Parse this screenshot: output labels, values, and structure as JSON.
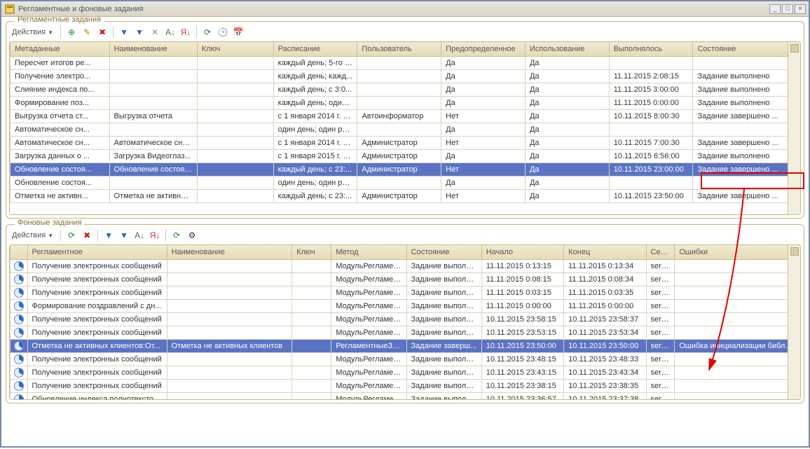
{
  "window": {
    "title": "Регламентные и фоновые задания",
    "min": "_",
    "max": "□",
    "close": "×"
  },
  "panel1": {
    "legend": "Регламентные задания",
    "actions": "Действия",
    "columns": [
      "Метаданные",
      "Наименование",
      "Ключ",
      "Расписание",
      "Пользователь",
      "Предопределенное",
      "Использование",
      "Выполнялось",
      "Состояние"
    ],
    "rows": [
      {
        "c": [
          "Пересчет итогов ре...",
          "",
          "",
          "каждый день; 5-го ч...",
          "",
          "Да",
          "Да",
          "",
          ""
        ]
      },
      {
        "c": [
          "Получение электро...",
          "",
          "",
          "каждый день; кажд...",
          "",
          "Да",
          "Да",
          "11.11.2015 2:08:15",
          "Задание выполнено"
        ]
      },
      {
        "c": [
          "Слияние индекса по...",
          "",
          "",
          "каждый день; с 3:0...",
          "",
          "Да",
          "Да",
          "11.11.2015 3:00:00",
          "Задание выполнено"
        ]
      },
      {
        "c": [
          "Формирование поз...",
          "",
          "",
          "каждый день; один ...",
          "",
          "Да",
          "Да",
          "11.11.2015 0:00:00",
          "Задание выполнено"
        ]
      },
      {
        "c": [
          "Выгрузка отчета ст...",
          "Выгрузка отчета",
          "",
          "с 1 января 2014 г. к...",
          "Автоинформатор",
          "Нет",
          "Да",
          "10.11.2015 8:00:30",
          "Задание завершено ..."
        ]
      },
      {
        "c": [
          "Автоматическое сн...",
          "",
          "",
          "один день; один раз...",
          "",
          "Да",
          "Да",
          "",
          ""
        ]
      },
      {
        "c": [
          "Автоматическое сн...",
          "Автоматическое сня...",
          "",
          "с 1 января 2014 г. к...",
          "Администратор",
          "Нет",
          "Да",
          "10.11.2015 7:00:30",
          "Задание завершено ..."
        ]
      },
      {
        "c": [
          "Загрузка данных о ...",
          "Загрузка Видеоглаз...",
          "",
          "с 1 января 2015 г. к...",
          "Администратор",
          "Да",
          "Да",
          "10.11.2015 6:56:00",
          "Задание выполнено"
        ]
      },
      {
        "c": [
          "Обновление состоя...",
          "Обновление состоян...",
          "",
          "каждый день; с 23:...",
          "Администратор",
          "Нет",
          "Да",
          "10.11.2015 23:00:00",
          "Задание завершено ..."
        ],
        "sel": true
      },
      {
        "c": [
          "Обновление состоя...",
          "",
          "",
          "один день; один раз...",
          "",
          "Да",
          "Да",
          "",
          ""
        ]
      },
      {
        "c": [
          "Отметка не активн...",
          "Отметка не активны...",
          "",
          "каждый день; с 23:...",
          "Администратор",
          "Нет",
          "Да",
          "10.11.2015 23:50:00",
          "Задание завершено ..."
        ]
      }
    ]
  },
  "panel2": {
    "legend": "Фоновые задания",
    "actions": "Действия",
    "columns": [
      "",
      "Регламентное",
      "Наименование",
      "Ключ",
      "Метод",
      "Состояние",
      "Начало",
      "Конец",
      "Сер...",
      "Ошибки"
    ],
    "rows": [
      {
        "c": [
          "",
          "Получение электронных сообщений",
          "",
          "",
          "МодульРегламен...",
          "Задание выполне...",
          "11.11.2015 0:13:15",
          "11.11.2015 0:13:34",
          "serv...",
          ""
        ]
      },
      {
        "c": [
          "",
          "Получение электронных сообщений",
          "",
          "",
          "МодульРегламен...",
          "Задание выполне...",
          "11.11.2015 0:08:15",
          "11.11.2015 0:08:34",
          "serv...",
          ""
        ]
      },
      {
        "c": [
          "",
          "Получение электронных сообщений",
          "",
          "",
          "МодульРегламен...",
          "Задание выполне...",
          "11.11.2015 0:03:15",
          "11.11.2015 0:03:35",
          "serv...",
          ""
        ]
      },
      {
        "c": [
          "",
          "Формирование поздравлений с дн...",
          "",
          "",
          "МодульРегламен...",
          "Задание выполне...",
          "11.11.2015 0:00:00",
          "11.11.2015 0:00:00",
          "serv...",
          ""
        ]
      },
      {
        "c": [
          "",
          "Получение электронных сообщений",
          "",
          "",
          "МодульРегламен...",
          "Задание выполне...",
          "10.11.2015 23:58:15",
          "10.11.2015 23:58:37",
          "serv...",
          ""
        ]
      },
      {
        "c": [
          "",
          "Получение электронных сообщений",
          "",
          "",
          "МодульРегламен...",
          "Задание выполне...",
          "10.11.2015 23:53:15",
          "10.11.2015 23:53:34",
          "serv...",
          ""
        ]
      },
      {
        "c": [
          "",
          "Отметка не активных клиентов:От...",
          "Отметка не активных клиентов",
          "",
          "РегламентныеЗа...",
          "Задание заверш...",
          "10.11.2015 23:50:00",
          "10.11.2015 23:50:00",
          "serv...",
          "Ошибка инициализации библи..."
        ],
        "sel": true
      },
      {
        "c": [
          "",
          "Получение электронных сообщений",
          "",
          "",
          "МодульРегламен...",
          "Задание выполне...",
          "10.11.2015 23:48:15",
          "10.11.2015 23:48:33",
          "serv...",
          ""
        ]
      },
      {
        "c": [
          "",
          "Получение электронных сообщений",
          "",
          "",
          "МодульРегламен...",
          "Задание выполне...",
          "10.11.2015 23:43:15",
          "10.11.2015 23:43:34",
          "serv...",
          ""
        ]
      },
      {
        "c": [
          "",
          "Получение электронных сообщений",
          "",
          "",
          "МодульРегламен...",
          "Задание выполне...",
          "10.11.2015 23:38:15",
          "10.11.2015 23:38:35",
          "serv...",
          ""
        ]
      },
      {
        "c": [
          "",
          "Обновление индекса полнотексто...",
          "",
          "",
          "МодульРегламен...",
          "Задание выполне...",
          "10.11.2015 23:36:57",
          "10.11.2015 23:37:38",
          "serv...",
          ""
        ]
      }
    ]
  },
  "toolbar_icons": {
    "add": "⊕",
    "edit": "✎",
    "delete": "✖",
    "refresh": "⟳",
    "clock": "🕒",
    "calendar": "📅",
    "filter": "▼",
    "sort_az": "A↓",
    "sort_za": "Я↓",
    "clear": "✕",
    "settings": "⚙"
  }
}
